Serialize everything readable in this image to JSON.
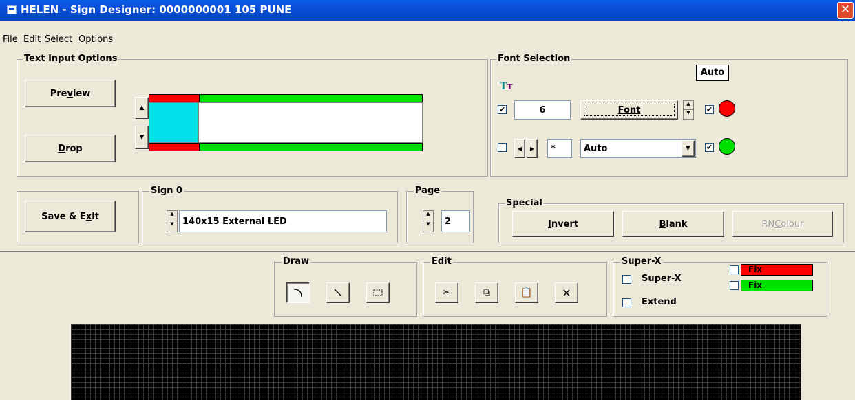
{
  "window": {
    "title": "HELEN - Sign Designer: 0000000001 105 PUNE",
    "close_label": "✕"
  },
  "menu": [
    "File",
    "Edit",
    "Select",
    "Options"
  ],
  "text_input": {
    "legend": "Text Input Options",
    "preview_pre": "Pre",
    "preview_u": "v",
    "preview_post": "iew",
    "drop_u": "D",
    "drop_post": "rop"
  },
  "font_selection": {
    "legend": "Font Selection",
    "auto_badge": "Auto",
    "size_value": "6",
    "font_label": "Font",
    "size_checked": true,
    "star_value": "*",
    "select_value": "Auto",
    "red_checked": true,
    "green_checked": true,
    "tt_checked": false
  },
  "save": {
    "pre": "Save & E",
    "u": "x",
    "post": "it"
  },
  "sign": {
    "legend": "Sign 0",
    "value": "140x15 External LED"
  },
  "page": {
    "legend": "Page",
    "value": "2"
  },
  "special": {
    "legend": "Special",
    "invert_u": "I",
    "invert_post": "nvert",
    "blank_u": "B",
    "blank_post": "lank",
    "rn_pre": "RN ",
    "rn_u": "C",
    "rn_post": "olour"
  },
  "draw": {
    "legend": "Draw"
  },
  "edit": {
    "legend": "Edit"
  },
  "superx": {
    "legend": "Super-X",
    "superx_label": "Super-X",
    "extend_label": "Extend",
    "fix_red_label": "Fix",
    "fix_green_label": "Fix"
  },
  "colors": {
    "red": "#ff0000",
    "green": "#00e000",
    "cyan": "#00e0e8"
  }
}
